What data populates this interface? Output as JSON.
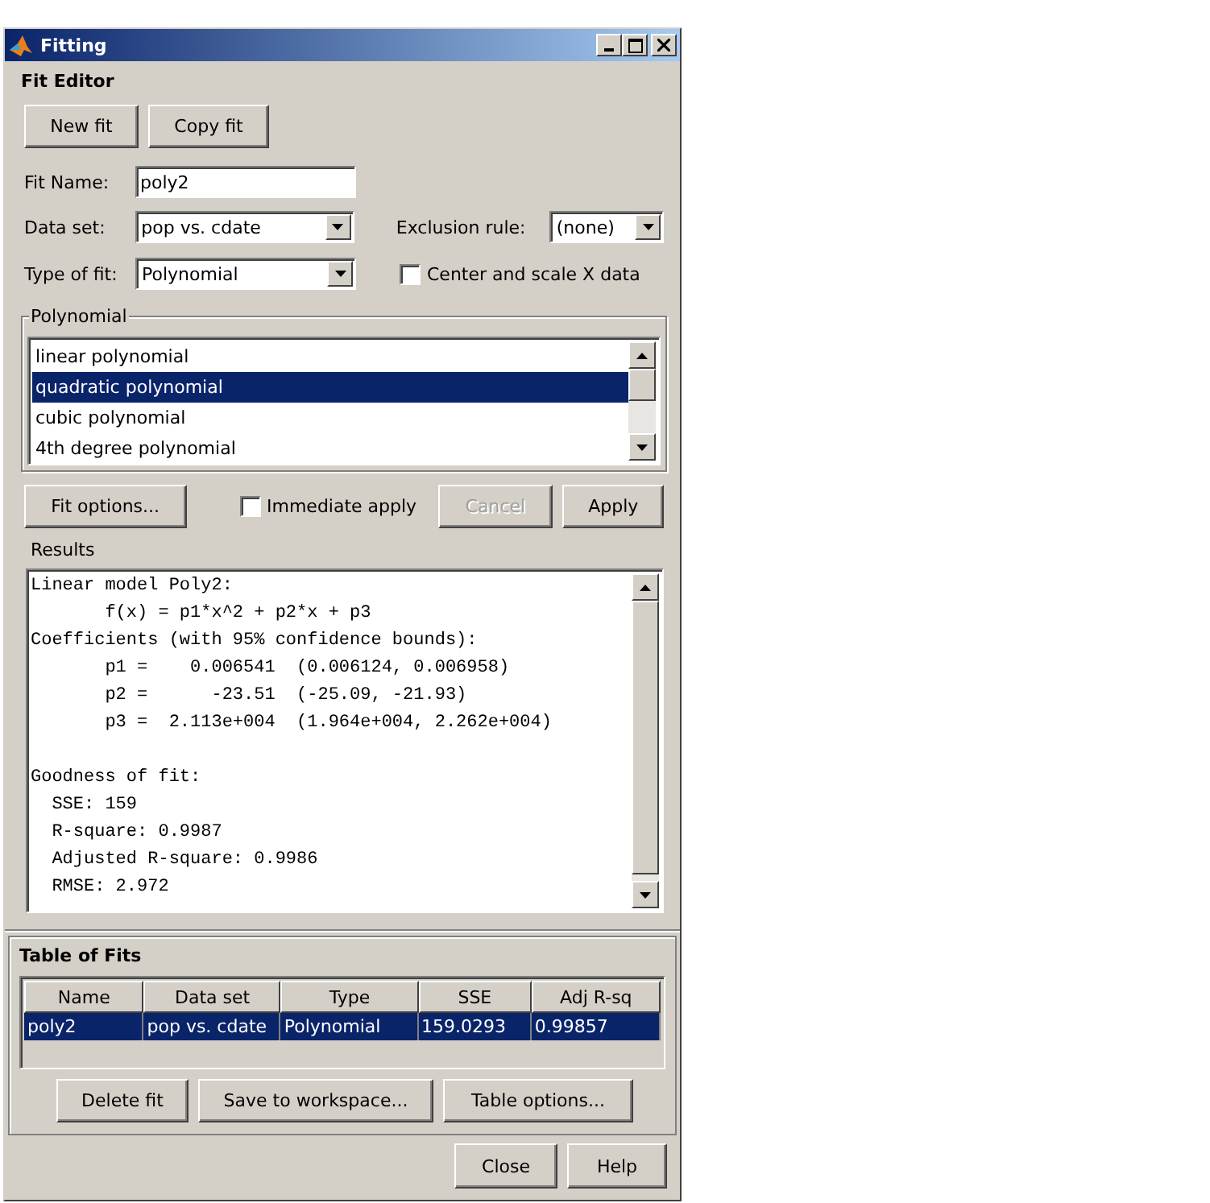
{
  "window": {
    "title": "Fitting"
  },
  "fit_editor": {
    "title": "Fit Editor",
    "buttons": [
      {
        "label": "New fit",
        "disabled": false
      },
      {
        "label": "Copy fit",
        "disabled": false
      }
    ],
    "fit_name": {
      "label": "Fit Name:",
      "value": "poly2"
    },
    "data_set": {
      "label": "Data set:",
      "value": "pop vs. cdate"
    },
    "exclusion_rule": {
      "label": "Exclusion rule:",
      "value": "(none)"
    },
    "type_of_fit": {
      "label": "Type of fit:",
      "value": "Polynomial"
    },
    "center_and_scale": {
      "label": "Center and scale X data",
      "checked": false
    },
    "polynomial": {
      "title": "Polynomial",
      "items": [
        {
          "label": "linear polynomial",
          "selected": false
        },
        {
          "label": "quadratic polynomial",
          "selected": true
        },
        {
          "label": "cubic polynomial",
          "selected": false
        },
        {
          "label": "4th degree polynomial",
          "selected": false
        }
      ]
    },
    "fit_options": {
      "label": "Fit options...",
      "disabled": false
    },
    "immediate_apply": {
      "label": "Immediate apply",
      "checked": false
    },
    "actions": [
      {
        "label": "Cancel",
        "disabled": true
      },
      {
        "label": "Apply",
        "disabled": false
      }
    ],
    "results": {
      "title": "Results",
      "paragraphs": [
        [
          "Linear model Poly2:",
          "       f(x) = p1*x^2 + p2*x + p3",
          "Coefficients (with 95% confidence bounds):",
          "       p1 =    0.006541  (0.006124, 0.006958)",
          "       p2 =      -23.51  (-25.09, -21.93)",
          "       p3 =  2.113e+004  (1.964e+004, 2.262e+004)"
        ],
        [
          "Goodness of fit:",
          "  SSE: 159",
          "  R-square: 0.9987",
          "  Adjusted R-square: 0.9986",
          "  RMSE: 2.972"
        ]
      ]
    }
  },
  "table_of_fits": {
    "title": "Table of Fits",
    "columns": [
      "Name",
      "Data set",
      "Type",
      "SSE",
      "Adj R-sq"
    ],
    "rows": [
      {
        "cells": [
          "poly2",
          "pop vs. cdate",
          "Polynomial",
          "159.0293",
          "0.99857"
        ],
        "selected": true
      }
    ],
    "buttons": [
      {
        "label": "Delete fit",
        "disabled": false
      },
      {
        "label": "Save to workspace...",
        "disabled": false
      },
      {
        "label": "Table options...",
        "disabled": false
      }
    ]
  },
  "footer_buttons": [
    {
      "label": "Close",
      "disabled": false
    },
    {
      "label": "Help",
      "disabled": false
    }
  ]
}
